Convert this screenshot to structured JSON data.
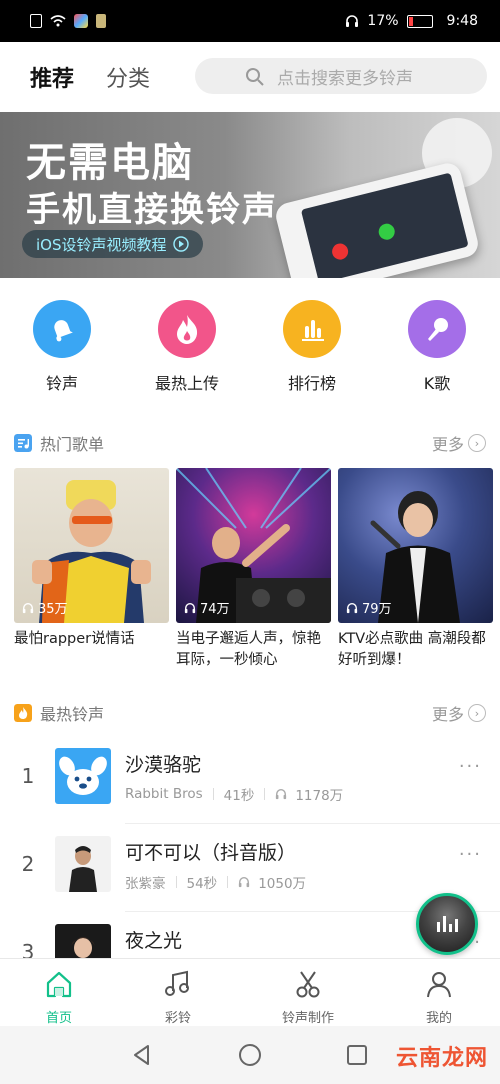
{
  "status": {
    "battery": "17%",
    "time": "9:48"
  },
  "header": {
    "tabs": [
      {
        "label": "推荐"
      },
      {
        "label": "分类"
      }
    ],
    "search_placeholder": "点击搜索更多铃声"
  },
  "banner": {
    "line1": "无需电脑",
    "line2": "手机直接换铃声",
    "pill": "iOS设铃声视频教程"
  },
  "quick": [
    {
      "label": "铃声",
      "icon": "bell-icon",
      "color": "#3aa6f3"
    },
    {
      "label": "最热上传",
      "icon": "flame-icon",
      "color": "#f2558a"
    },
    {
      "label": "排行榜",
      "icon": "bar-chart-icon",
      "color": "#f7b320"
    },
    {
      "label": "K歌",
      "icon": "microphone-icon",
      "color": "#a46ee8"
    }
  ],
  "playlists": {
    "title": "热门歌单",
    "more": "更多",
    "items": [
      {
        "plays": "35万",
        "title": "最怕rapper说情话"
      },
      {
        "plays": "74万",
        "title": "当电子邂逅人声，惊艳耳际，一秒倾心"
      },
      {
        "plays": "79万",
        "title": "KTV必点歌曲 高潮段都好听到爆！"
      }
    ]
  },
  "hot": {
    "title": "最热铃声",
    "more": "更多",
    "songs": [
      {
        "rank": "1",
        "name": "沙漠骆驼",
        "artist": "Rabbit Bros",
        "duration": "41秒",
        "plays": "1178万"
      },
      {
        "rank": "2",
        "name": "可不可以（抖音版）",
        "artist": "张紫豪",
        "duration": "54秒",
        "plays": "1050万"
      },
      {
        "rank": "3",
        "name": "夜之光",
        "artist": "",
        "duration": "",
        "plays": ""
      }
    ]
  },
  "bottomnav": [
    {
      "label": "首页"
    },
    {
      "label": "彩铃"
    },
    {
      "label": "铃声制作"
    },
    {
      "label": "我的"
    }
  ],
  "watermark": "云南龙网",
  "colors": {
    "accent": "#12c08a"
  }
}
